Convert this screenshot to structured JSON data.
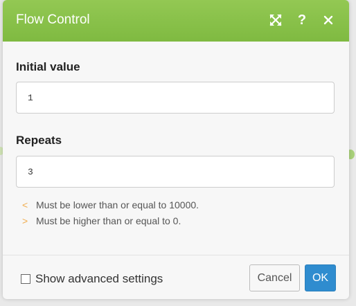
{
  "dialog": {
    "title": "Flow Control",
    "header_icons": [
      "fullscreen-icon",
      "help-icon",
      "close-icon"
    ],
    "help_label": "?",
    "accent_color": "#8bc34a"
  },
  "fields": {
    "initial_value": {
      "label": "Initial value",
      "value": "1"
    },
    "repeats": {
      "label": "Repeats",
      "value": "3"
    }
  },
  "hints": [
    {
      "mark": "<",
      "text": "Must be lower than or equal to 10000."
    },
    {
      "mark": ">",
      "text": "Must be higher than or equal to 0."
    }
  ],
  "footer": {
    "advanced_label": "Show advanced settings",
    "advanced_checked": false,
    "cancel_label": "Cancel",
    "ok_label": "OK",
    "ok_color": "#2f8ccf"
  }
}
